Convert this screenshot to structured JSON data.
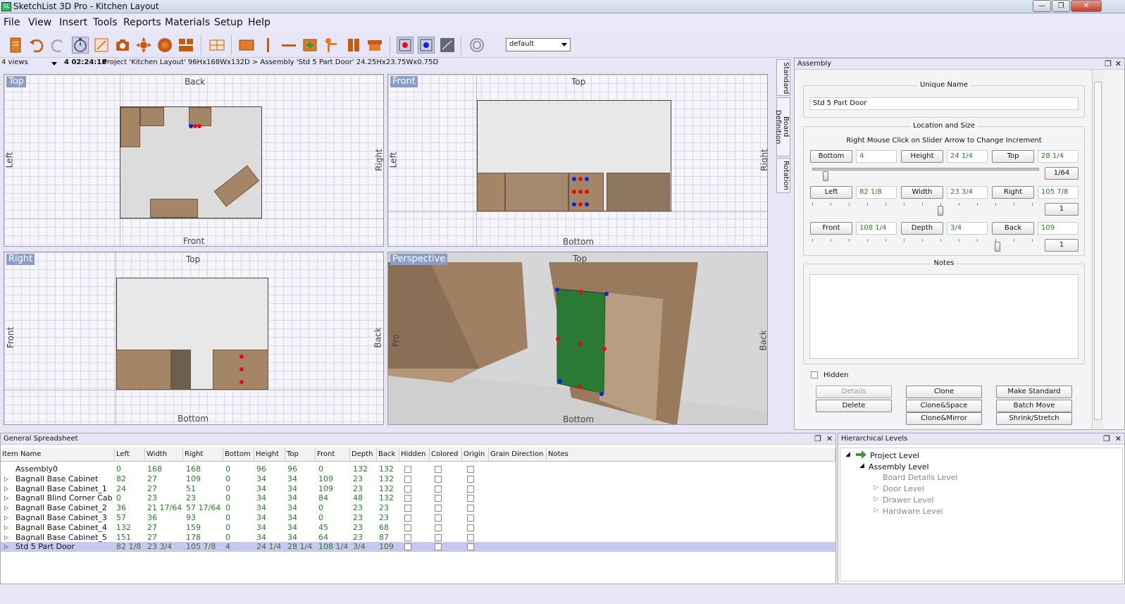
{
  "window": {
    "title": "SketchList 3D Pro - Kitchen Layout",
    "app_icon": "SL"
  },
  "menu": [
    "File",
    "View",
    "Insert",
    "Tools",
    "Reports",
    "Materials",
    "Setup",
    "Help"
  ],
  "toolbar": {
    "combo_value": "default"
  },
  "pathbar": {
    "views": "4 views",
    "time": "4 02:24:18",
    "path": "Project 'Kitchen Layout' 96Hx168Wx132D > Assembly 'Std 5 Part Door' 24.25Hx23.75Wx0.75D"
  },
  "views": {
    "top": {
      "tag": "Top",
      "top": "Back",
      "bottom": "Front",
      "left": "Left",
      "right": "Right"
    },
    "front": {
      "tag": "Front",
      "top": "Top",
      "bottom": "Bottom",
      "left": "Left",
      "right": "Right"
    },
    "right": {
      "tag": "Right",
      "top": "Top",
      "bottom": "Bottom",
      "left": "Front",
      "right": "Back"
    },
    "persp": {
      "tag": "Perspective",
      "top": "Top",
      "bottom": "Bottom",
      "left": "Fro",
      "right": "Back"
    }
  },
  "sidetabs": [
    "Standard",
    "Board Definition",
    "Rotation"
  ],
  "assembly": {
    "title": "Assembly",
    "unique_name_title": "Unique Name",
    "unique_name": "Std 5 Part Door",
    "loc_title": "Location and Size",
    "hint": "Right Mouse Click on Slider Arrow to Change Increment",
    "bottom_label": "Bottom",
    "bottom": "4",
    "height_label": "Height",
    "height": "24 1/4",
    "top_label": "Top",
    "top": "28 1/4",
    "inc1": "1/64",
    "left_label": "Left",
    "left": "82 1/8",
    "width_label": "Width",
    "width": "23 3/4",
    "right_label": "Right",
    "right": "105 7/8",
    "inc2": "1",
    "front_label": "Front",
    "front": "108 1/4",
    "depth_label": "Depth",
    "depth": "3/4",
    "back_label": "Back",
    "back": "109",
    "inc3": "1",
    "notes_title": "Notes",
    "hidden_label": "Hidden",
    "buttons": {
      "details": "Details",
      "delete": "Delete",
      "clone": "Clone",
      "clone_space": "Clone&Space",
      "clone_mirror": "Clone&Mirror",
      "make_standard": "Make Standard",
      "batch_move": "Batch Move",
      "shrink": "Shrink/Stretch"
    }
  },
  "spreadsheet": {
    "title": "General Spreadsheet",
    "columns": [
      "Item Name",
      "Left",
      "Width",
      "Right",
      "Bottom",
      "Height",
      "Top",
      "Front",
      "Depth",
      "Back",
      "Hidden",
      "Colored",
      "Origin",
      "Grain Direction",
      "Notes"
    ],
    "rows": [
      {
        "name": "Assembly0",
        "v": [
          "0",
          "168",
          "168",
          "0",
          "96",
          "96",
          "0",
          "132",
          "132"
        ]
      },
      {
        "name": "Bagnall Base Cabinet",
        "v": [
          "82",
          "27",
          "109",
          "0",
          "34",
          "34",
          "109",
          "23",
          "132"
        ]
      },
      {
        "name": "Bagnall Base Cabinet_1",
        "v": [
          "24",
          "27",
          "51",
          "0",
          "34",
          "34",
          "109",
          "23",
          "132"
        ]
      },
      {
        "name": "Bagnall Blind Corner Cab",
        "v": [
          "0",
          "23",
          "23",
          "0",
          "34",
          "34",
          "84",
          "48",
          "132"
        ]
      },
      {
        "name": "Bagnall Base Cabinet_2",
        "v": [
          "36",
          "21 17/64",
          "57 17/64",
          "0",
          "34",
          "34",
          "0",
          "23",
          "23"
        ]
      },
      {
        "name": "Bagnall Base Cabinet_3",
        "v": [
          "57",
          "36",
          "93",
          "0",
          "34",
          "34",
          "0",
          "23",
          "23"
        ]
      },
      {
        "name": "Bagnall Base Cabinet_4",
        "v": [
          "132",
          "27",
          "159",
          "0",
          "34",
          "34",
          "45",
          "23",
          "68"
        ]
      },
      {
        "name": "Bagnall Base Cabinet_5",
        "v": [
          "151",
          "27",
          "178",
          "0",
          "34",
          "34",
          "64",
          "23",
          "87"
        ]
      },
      {
        "name": "Std 5 Part Door",
        "v": [
          "82 1/8",
          "23 3/4",
          "105 7/8",
          "4",
          "24 1/4",
          "28 1/4",
          "108 1/4",
          "3/4",
          "109"
        ]
      }
    ]
  },
  "hierarchy": {
    "title": "Hierarchical Levels",
    "items": [
      "Project Level",
      "Assembly Level",
      "Board Details Level",
      "Door Level",
      "Drawer Level",
      "Hardware Level"
    ]
  },
  "colors": {
    "accent": "#8a9cc8",
    "wood": "#a48566",
    "selection": "#c8c8f0",
    "green_text": "#2a7a2a"
  }
}
